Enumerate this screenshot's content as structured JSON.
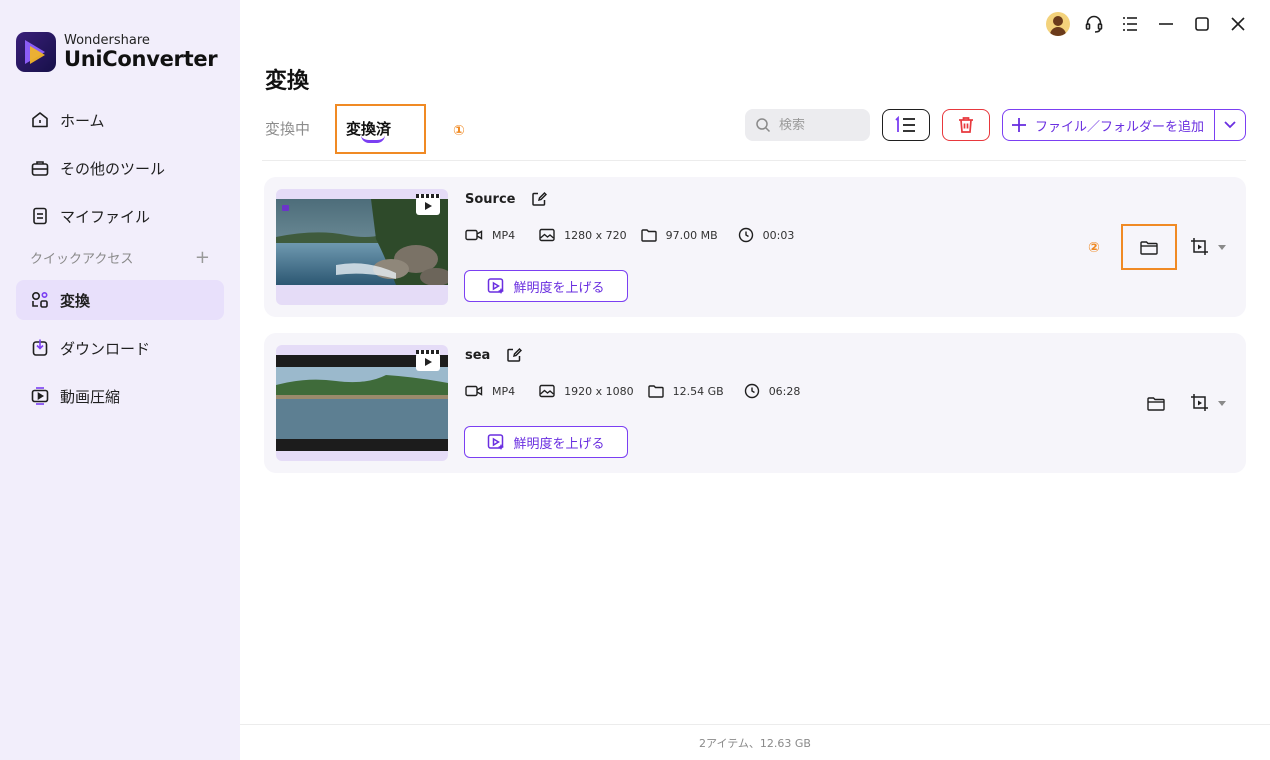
{
  "app": {
    "brand_small": "Wondershare",
    "brand_big": "UniConverter"
  },
  "sidebar": {
    "items": [
      {
        "label": "ホーム",
        "icon": "home-icon"
      },
      {
        "label": "その他のツール",
        "icon": "toolbox-icon"
      },
      {
        "label": "マイファイル",
        "icon": "file-icon"
      }
    ],
    "quick_access_label": "クイックアクセス",
    "quick_add": "+",
    "quick_items": [
      {
        "label": "変換",
        "icon": "convert-icon",
        "active": true
      },
      {
        "label": "ダウンロード",
        "icon": "download-icon"
      },
      {
        "label": "動画圧縮",
        "icon": "compress-icon"
      }
    ]
  },
  "header": {
    "title": "変換",
    "tabs": [
      {
        "label": "変換中"
      },
      {
        "label": "変換済",
        "active": true
      }
    ],
    "marker1": "①",
    "marker2": "②",
    "search_placeholder": "検索",
    "add_button_label": "ファイル／フォルダーを追加"
  },
  "files": [
    {
      "name": "Source",
      "format": "MP4",
      "resolution": "1280 x 720",
      "size": "97.00 MB",
      "duration": "00:03",
      "enhance_label": "鮮明度を上げる"
    },
    {
      "name": "sea",
      "format": "MP4",
      "resolution": "1920 x 1080",
      "size": "12.54 GB",
      "duration": "06:28",
      "enhance_label": "鮮明度を上げる"
    }
  ],
  "status": {
    "summary": "2アイテム、12.63 GB"
  },
  "colors": {
    "accent": "#7b3ff2",
    "highlight": "#f08a24",
    "delete": "#e8383d",
    "sidebar_bg": "#f2eefb"
  }
}
